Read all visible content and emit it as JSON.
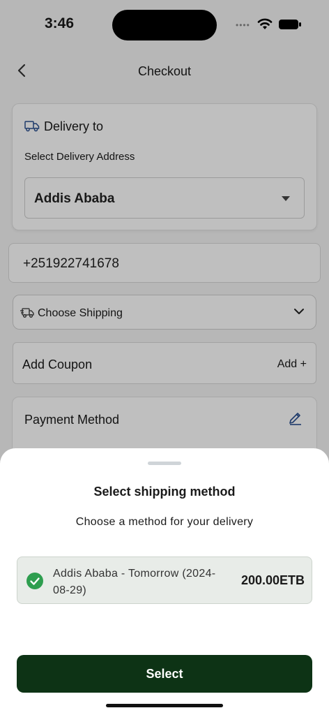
{
  "status_bar": {
    "time": "3:46",
    "signal_dots": "••••"
  },
  "header": {
    "title": "Checkout",
    "back_icon": "chevron-left-icon"
  },
  "delivery_card": {
    "title": "Delivery to",
    "icon": "truck-icon",
    "subtitle": "Select Delivery Address",
    "selected_address": "Addis Ababa"
  },
  "phone": {
    "value": "+251922741678"
  },
  "shipping": {
    "label": "Choose Shipping",
    "icon": "shipping-truck-icon"
  },
  "coupon": {
    "label": "Add Coupon",
    "action": "Add +"
  },
  "payment": {
    "label": "Payment Method",
    "icon": "edit-icon"
  },
  "sheet": {
    "title": "Select shipping method",
    "subtitle": "Choose a method for your delivery",
    "options": [
      {
        "name": "Addis Ababa - Tomorrow (2024-08-29)",
        "price": "200.00ETB",
        "selected": true
      }
    ],
    "select_label": "Select"
  },
  "colors": {
    "primary": "#0d3315",
    "check": "#2e9e4f",
    "accent_icon": "#2a4f8f"
  }
}
